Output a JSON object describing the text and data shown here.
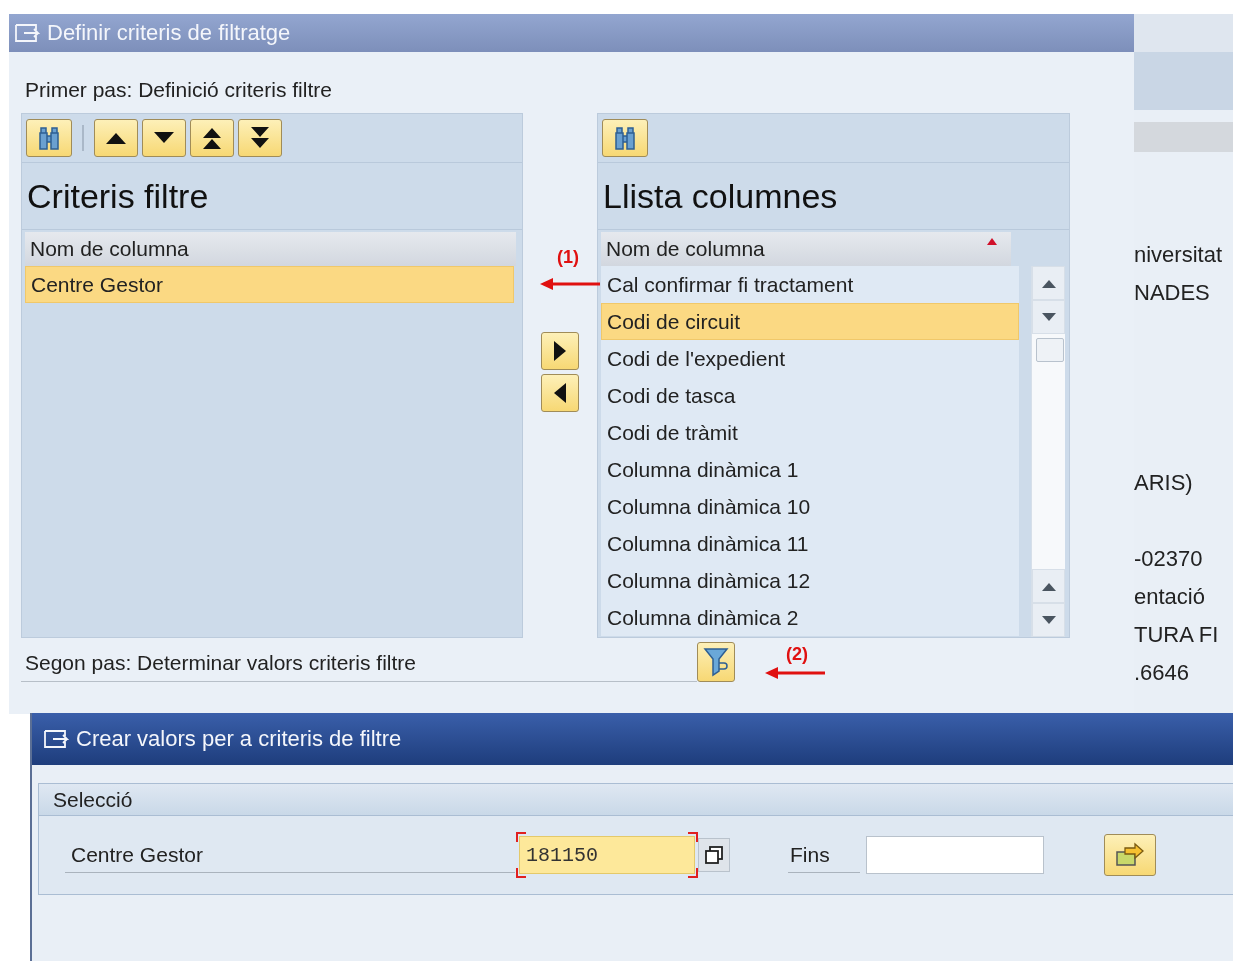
{
  "background_window": {
    "lines": [
      "niversitat",
      "NADES",
      "ARIS)",
      "-02370",
      "entació",
      "TURA FI",
      ".6646"
    ]
  },
  "filter_dialog": {
    "title": "Definir criteris de filtratge",
    "step1": "Primer pas: Definició criteris filtre",
    "left_panel": {
      "title": "Criteris filtre",
      "column_header": "Nom de columna",
      "rows": [
        {
          "text": "Centre Gestor",
          "selected": true
        }
      ]
    },
    "right_panel": {
      "title": "Llista columnes",
      "column_header": "Nom de columna",
      "rows": [
        {
          "text": "Cal confirmar fi tractament",
          "selected": false
        },
        {
          "text": "Codi de circuit",
          "selected": true
        },
        {
          "text": "Codi de l'expedient",
          "selected": false
        },
        {
          "text": "Codi de tasca",
          "selected": false
        },
        {
          "text": "Codi de tràmit",
          "selected": false
        },
        {
          "text": "Columna dinàmica 1",
          "selected": false
        },
        {
          "text": "Columna dinàmica 10",
          "selected": false
        },
        {
          "text": "Columna dinàmica 11",
          "selected": false
        },
        {
          "text": "Columna dinàmica 12",
          "selected": false
        },
        {
          "text": "Columna dinàmica 2",
          "selected": false
        }
      ]
    },
    "step2": "Segon pas: Determinar valors criteris filtre"
  },
  "annotations": [
    {
      "label": "(1)"
    },
    {
      "label": "(2)"
    }
  ],
  "values_dialog": {
    "title": "Crear valors per a criteris de filtre",
    "section": "Selecció",
    "field_label": "Centre Gestor",
    "from_value": "181150",
    "to_label": "Fins"
  }
}
